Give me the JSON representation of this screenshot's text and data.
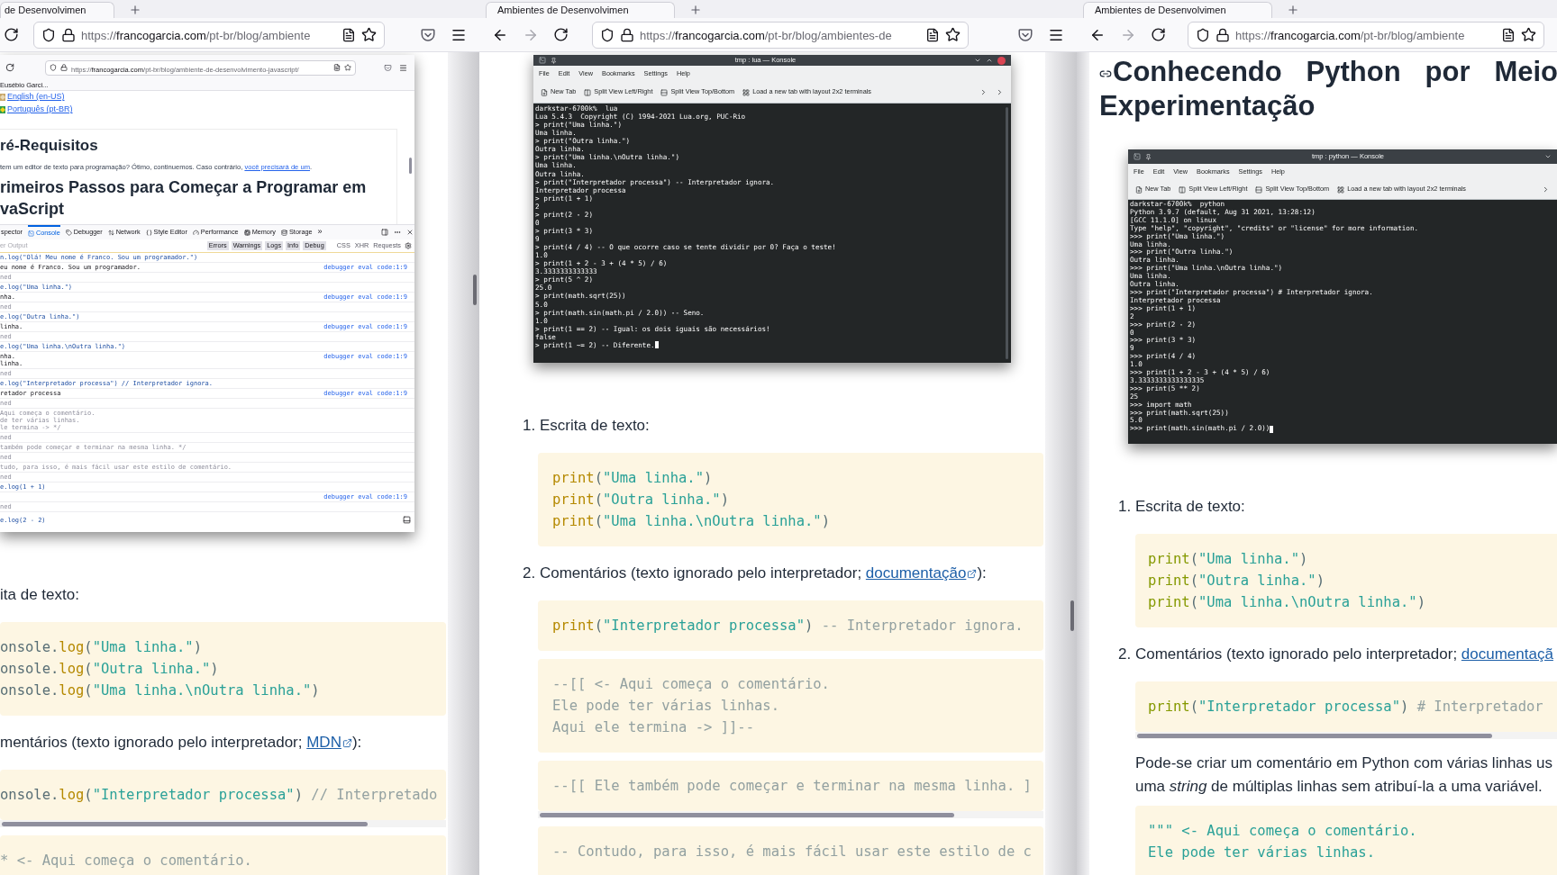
{
  "windows": [
    {
      "kind": "cropped_left",
      "tab": "de Desenvolvimen",
      "url": {
        "scheme": "https://",
        "domain": "francogarcia.com",
        "path": "/pt-br/blog/ambiente"
      },
      "blocks": [
        {
          "kind": "browser_shot",
          "url": {
            "scheme": "https://",
            "domain": "francogarcia.com",
            "path": "/pt-br/blog/ambiente-de-desenvolvimento-javascript/"
          },
          "bookmark": "Eusébio Garci...",
          "languages": [
            "English (en-US)",
            "Português (pt-BR)"
          ],
          "heading": "ré-Requisitos",
          "paragraph": {
            "text": "tem um editor de texto para programação? Ótimo, continuemos. Caso contrário, ",
            "link": "você precisará de um",
            "after": "."
          },
          "heading2": "rimeiros Passos para Começar a Programar em vaScript",
          "devtools": {
            "tabs": [
              {
                "label": "spector",
                "selected": false
              },
              {
                "label": "Console",
                "selected": true
              },
              {
                "label": "Debugger",
                "selected": false
              },
              {
                "label": "Network",
                "selected": false
              },
              {
                "label": "Style Editor",
                "selected": false
              },
              {
                "label": "Performance",
                "selected": false
              },
              {
                "label": "Memory",
                "selected": false
              },
              {
                "label": "Storage",
                "selected": false
              }
            ],
            "more": "»",
            "filter_placeholder": "er Output",
            "levels": [
              "Errors",
              "Warnings",
              "Logs",
              "Info",
              "Debug"
            ],
            "types": [
              "CSS",
              "XHR",
              "Requests"
            ],
            "rows": [
              {
                "kind": "input",
                "lines": [
                  "n.log(\"Olá! Meu nome é Franco. Sou um programador.\")"
                ]
              },
              {
                "kind": "output",
                "lines": [
                  "eu nome é Franco. Sou um programador."
                ],
                "source": "debugger eval code:1:9"
              },
              {
                "kind": "undefined",
                "lines": [
                  "ned"
                ]
              },
              {
                "kind": "input",
                "lines": [
                  "e.log(\"Uma linha.\")"
                ]
              },
              {
                "kind": "output",
                "lines": [
                  "nha."
                ],
                "source": "debugger eval code:1:9"
              },
              {
                "kind": "undefined",
                "lines": [
                  "ned"
                ]
              },
              {
                "kind": "input",
                "lines": [
                  "e.log(\"Outra linha.\")"
                ]
              },
              {
                "kind": "output",
                "lines": [
                  "linha."
                ],
                "source": "debugger eval code:1:9"
              },
              {
                "kind": "undefined",
                "lines": [
                  "ned"
                ]
              },
              {
                "kind": "input",
                "lines": [
                  "e.log(\"Uma linha.\\nOutra linha.\")"
                ]
              },
              {
                "kind": "output",
                "lines": [
                  "nha.",
                  "linha."
                ],
                "source": "debugger eval code:1:9"
              },
              {
                "kind": "undefined",
                "lines": [
                  "ned"
                ]
              },
              {
                "kind": "input",
                "lines": [
                  "e.log(\"Interpretador processa\") // Interpretador ignora."
                ]
              },
              {
                "kind": "output",
                "lines": [
                  "retador processa"
                ],
                "source": "debugger eval code:1:9"
              },
              {
                "kind": "undefined",
                "lines": [
                  "ned"
                ]
              },
              {
                "kind": "comment",
                "lines": [
                  "Aqui começa o comentário.",
                  "de ter várias linhas.",
                  "le termina -> */"
                ]
              },
              {
                "kind": "undefined",
                "lines": [
                  "ned"
                ]
              },
              {
                "kind": "comment",
                "lines": [
                  "também pode começar e terminar na mesma linha. */"
                ]
              },
              {
                "kind": "undefined",
                "lines": [
                  "ned"
                ]
              },
              {
                "kind": "comment",
                "lines": [
                  "tudo, para isso, é mais fácil usar este estilo de comentário."
                ]
              },
              {
                "kind": "undefined",
                "lines": [
                  "ned"
                ]
              },
              {
                "kind": "input",
                "lines": [
                  "e.log(1 + 1)"
                ]
              },
              {
                "kind": "output",
                "source": "debugger eval code:1:9"
              },
              {
                "kind": "undefined",
                "lines": [
                  "ned"
                ]
              }
            ],
            "input": "e.log(2 - 2)"
          }
        },
        {
          "kind": "list_item",
          "text": "ita de texto:"
        },
        {
          "kind": "code",
          "lines": [
            [
              {
                "kind": "plain",
                "text": "onsole."
              },
              {
                "kind": "function",
                "text": "log"
              },
              {
                "kind": "plain",
                "text": "("
              },
              {
                "kind": "string",
                "text": "\"Uma linha.\""
              },
              {
                "kind": "plain",
                "text": ")"
              }
            ],
            [
              {
                "kind": "plain",
                "text": "onsole."
              },
              {
                "kind": "function",
                "text": "log"
              },
              {
                "kind": "plain",
                "text": "("
              },
              {
                "kind": "string",
                "text": "\"Outra linha.\""
              },
              {
                "kind": "plain",
                "text": ")"
              }
            ],
            [
              {
                "kind": "plain",
                "text": "onsole."
              },
              {
                "kind": "function",
                "text": "log"
              },
              {
                "kind": "plain",
                "text": "("
              },
              {
                "kind": "string",
                "text": "\"Uma linha.\\nOutra linha.\""
              },
              {
                "kind": "plain",
                "text": ")"
              }
            ]
          ]
        },
        {
          "kind": "list_item",
          "text": "mentários (texto ignorado pelo interpretador; ",
          "link": "MDN",
          "after": "):"
        },
        {
          "kind": "code",
          "scrollbar": true,
          "lines": [
            [
              {
                "kind": "plain",
                "text": "onsole."
              },
              {
                "kind": "function",
                "text": "log"
              },
              {
                "kind": "plain",
                "text": "("
              },
              {
                "kind": "string",
                "text": "\"Interpretador processa\""
              },
              {
                "kind": "plain",
                "text": ")"
              },
              {
                "kind": "comment",
                "text": " // Interpretado"
              }
            ]
          ]
        },
        {
          "kind": "code",
          "lines": [
            [
              {
                "kind": "comment",
                "text": "* <- Aqui começa o comentário."
              }
            ]
          ]
        }
      ]
    },
    {
      "kind": "full",
      "tab": "Ambientes de Desenvolvimen",
      "forward_disabled": true,
      "url": {
        "scheme": "https://",
        "domain": "francogarcia.com",
        "path": "/pt-br/blog/ambientes-de"
      },
      "blocks": [
        {
          "kind": "terminal",
          "cropped_right": false,
          "title": "tmp : lua — Konsole",
          "menu": [
            "File",
            "Edit",
            "View",
            "Bookmarks",
            "Settings",
            "Help"
          ],
          "toolbar": [
            "New Tab",
            "Split View Left/Right",
            "Split View Top/Bottom",
            "Load a new tab with layout 2x2 terminals"
          ],
          "cursor": true,
          "lines": [
            "darkstar-6700k%  lua",
            "Lua 5.4.3  Copyright (C) 1994-2021 Lua.org, PUC-Rio",
            "> print(\"Uma linha.\")",
            "Uma linha.",
            "> print(\"Outra linha.\")",
            "Outra linha.",
            "> print(\"Uma linha.\\nOutra linha.\")",
            "Uma linha.",
            "Outra linha.",
            "> print(\"Interpretador processa\") -- Interpretador ignora.",
            "Interpretador processa",
            "> print(1 + 1)",
            "2",
            "> print(2 - 2)",
            "0",
            "> print(3 * 3)",
            "9",
            "> print(4 / 4) -- O que ocorre caso se tente dividir por 0? Faça o teste!",
            "1.0",
            "> print(1 + 2 - 3 + (4 * 5) / 6)",
            "3.3333333333333",
            "> print(5 ^ 2)",
            "25.0",
            "> print(math.sqrt(25))",
            "5.0",
            "> print(math.sin(math.pi / 2.0)) -- Seno.",
            "1.0",
            "> print(1 == 2) -- Igual: os dois iguais são necessários!",
            "false",
            "> print(1 ~= 2) -- Diferente."
          ]
        },
        {
          "kind": "list_item",
          "number": "1.",
          "text": "Escrita de texto:"
        },
        {
          "kind": "code",
          "lines": [
            [
              {
                "kind": "function",
                "text": "print"
              },
              {
                "kind": "plain",
                "text": "("
              },
              {
                "kind": "string",
                "text": "\"Uma linha.\""
              },
              {
                "kind": "plain",
                "text": ")"
              }
            ],
            [
              {
                "kind": "function",
                "text": "print"
              },
              {
                "kind": "plain",
                "text": "("
              },
              {
                "kind": "string",
                "text": "\"Outra linha.\""
              },
              {
                "kind": "plain",
                "text": ")"
              }
            ],
            [
              {
                "kind": "function",
                "text": "print"
              },
              {
                "kind": "plain",
                "text": "("
              },
              {
                "kind": "string",
                "text": "\"Uma linha.\\nOutra linha.\""
              },
              {
                "kind": "plain",
                "text": ")"
              }
            ]
          ]
        },
        {
          "kind": "list_item",
          "number": "2.",
          "text": "Comentários (texto ignorado pelo interpretador; ",
          "link": "documentação",
          "after": "):"
        },
        {
          "kind": "code",
          "lines": [
            [
              {
                "kind": "function",
                "text": "print"
              },
              {
                "kind": "plain",
                "text": "("
              },
              {
                "kind": "string",
                "text": "\"Interpretador processa\""
              },
              {
                "kind": "plain",
                "text": ")"
              },
              {
                "kind": "comment",
                "text": " -- Interpretador ignora."
              }
            ]
          ]
        },
        {
          "kind": "code",
          "lines": [
            [
              {
                "kind": "comment",
                "text": "--[[ <- Aqui começa o comentário."
              }
            ],
            [
              {
                "kind": "comment",
                "text": "Ele pode ter várias linhas."
              }
            ],
            [
              {
                "kind": "comment",
                "text": "Aqui ele termina -> ]]--"
              }
            ]
          ]
        },
        {
          "kind": "code",
          "scrollbar": true,
          "lines": [
            [
              {
                "kind": "comment",
                "text": "--[[ Ele também pode começar e terminar na mesma linha. ]"
              }
            ]
          ]
        },
        {
          "kind": "code",
          "lines": [
            [
              {
                "kind": "comment",
                "text": "-- Contudo, para isso, é mais fácil usar este estilo de c"
              }
            ]
          ]
        }
      ]
    },
    {
      "kind": "cropped_right",
      "tab": "Ambientes de Desenvolvimen",
      "forward_disabled": true,
      "url": {
        "scheme": "https://",
        "domain": "francogarcia.com",
        "path": "/pt-br/blog/ambiente"
      },
      "blocks": [
        {
          "kind": "heading",
          "text": "Conhecendo Python por Meio Experimentação"
        },
        {
          "kind": "terminal",
          "cropped_right": true,
          "title": "tmp : python — Konsole",
          "menu": [
            "File",
            "Edit",
            "View",
            "Bookmarks",
            "Settings",
            "Help"
          ],
          "toolbar": [
            "New Tab",
            "Split View Left/Right",
            "Split View Top/Bottom",
            "Load a new tab with layout 2x2 terminals"
          ],
          "cursor": true,
          "lines": [
            "darkstar-6700k%  python",
            "Python 3.9.7 (default, Aug 31 2021, 13:28:12)",
            "[GCC 11.1.0] on linux",
            "Type \"help\", \"copyright\", \"credits\" or \"license\" for more information.",
            ">>> print(\"Uma linha.\")",
            "Uma linha.",
            ">>> print(\"Outra linha.\")",
            "Outra linha.",
            ">>> print(\"Uma linha.\\nOutra linha.\")",
            "Uma linha.",
            "Outra linha.",
            ">>> print(\"Interpretador processa\") # Interpretador ignora.",
            "Interpretador processa",
            ">>> print(1 + 1)",
            "2",
            ">>> print(2 - 2)",
            "0",
            ">>> print(3 * 3)",
            "9",
            ">>> print(4 / 4)",
            "1.0",
            ">>> print(1 + 2 - 3 + (4 * 5) / 6)",
            "3.3333333333333335",
            ">>> print(5 ** 2)",
            "25",
            ">>> import math",
            ">>> print(math.sqrt(25))",
            "5.0",
            ">>> print(math.sin(math.pi / 2.0))"
          ]
        },
        {
          "kind": "list_item",
          "number": "1.",
          "text": "Escrita de texto:"
        },
        {
          "kind": "code",
          "lines": [
            [
              {
                "kind": "builtin",
                "text": "print"
              },
              {
                "kind": "plain",
                "text": "("
              },
              {
                "kind": "string",
                "text": "\"Uma linha.\""
              },
              {
                "kind": "plain",
                "text": ")"
              }
            ],
            [
              {
                "kind": "builtin",
                "text": "print"
              },
              {
                "kind": "plain",
                "text": "("
              },
              {
                "kind": "string",
                "text": "\"Outra linha.\""
              },
              {
                "kind": "plain",
                "text": ")"
              }
            ],
            [
              {
                "kind": "builtin",
                "text": "print"
              },
              {
                "kind": "plain",
                "text": "("
              },
              {
                "kind": "string",
                "text": "\"Uma linha.\\nOutra linha.\""
              },
              {
                "kind": "plain",
                "text": ")"
              }
            ]
          ]
        },
        {
          "kind": "list_item",
          "number": "2.",
          "text": "Comentários (texto ignorado pelo interpretador; ",
          "link": "documentaçã"
        },
        {
          "kind": "code",
          "scrollbar": true,
          "lines": [
            [
              {
                "kind": "builtin",
                "text": "print"
              },
              {
                "kind": "plain",
                "text": "("
              },
              {
                "kind": "string",
                "text": "\"Interpretador processa\""
              },
              {
                "kind": "plain",
                "text": ")"
              },
              {
                "kind": "comment",
                "text": " # Interpretador"
              }
            ]
          ]
        },
        {
          "kind": "paragraph",
          "lines": [
            "Pode-se criar um comentário em Python com várias linhas us",
            "uma *string* de múltiplas linhas sem atribuí-la a uma variável."
          ]
        },
        {
          "kind": "code",
          "lines": [
            [
              {
                "kind": "string",
                "text": "\"\"\" <- Aqui começa o comentário."
              }
            ],
            [
              {
                "kind": "string",
                "text": "Ele pode ter várias linhas."
              }
            ]
          ]
        }
      ]
    }
  ]
}
